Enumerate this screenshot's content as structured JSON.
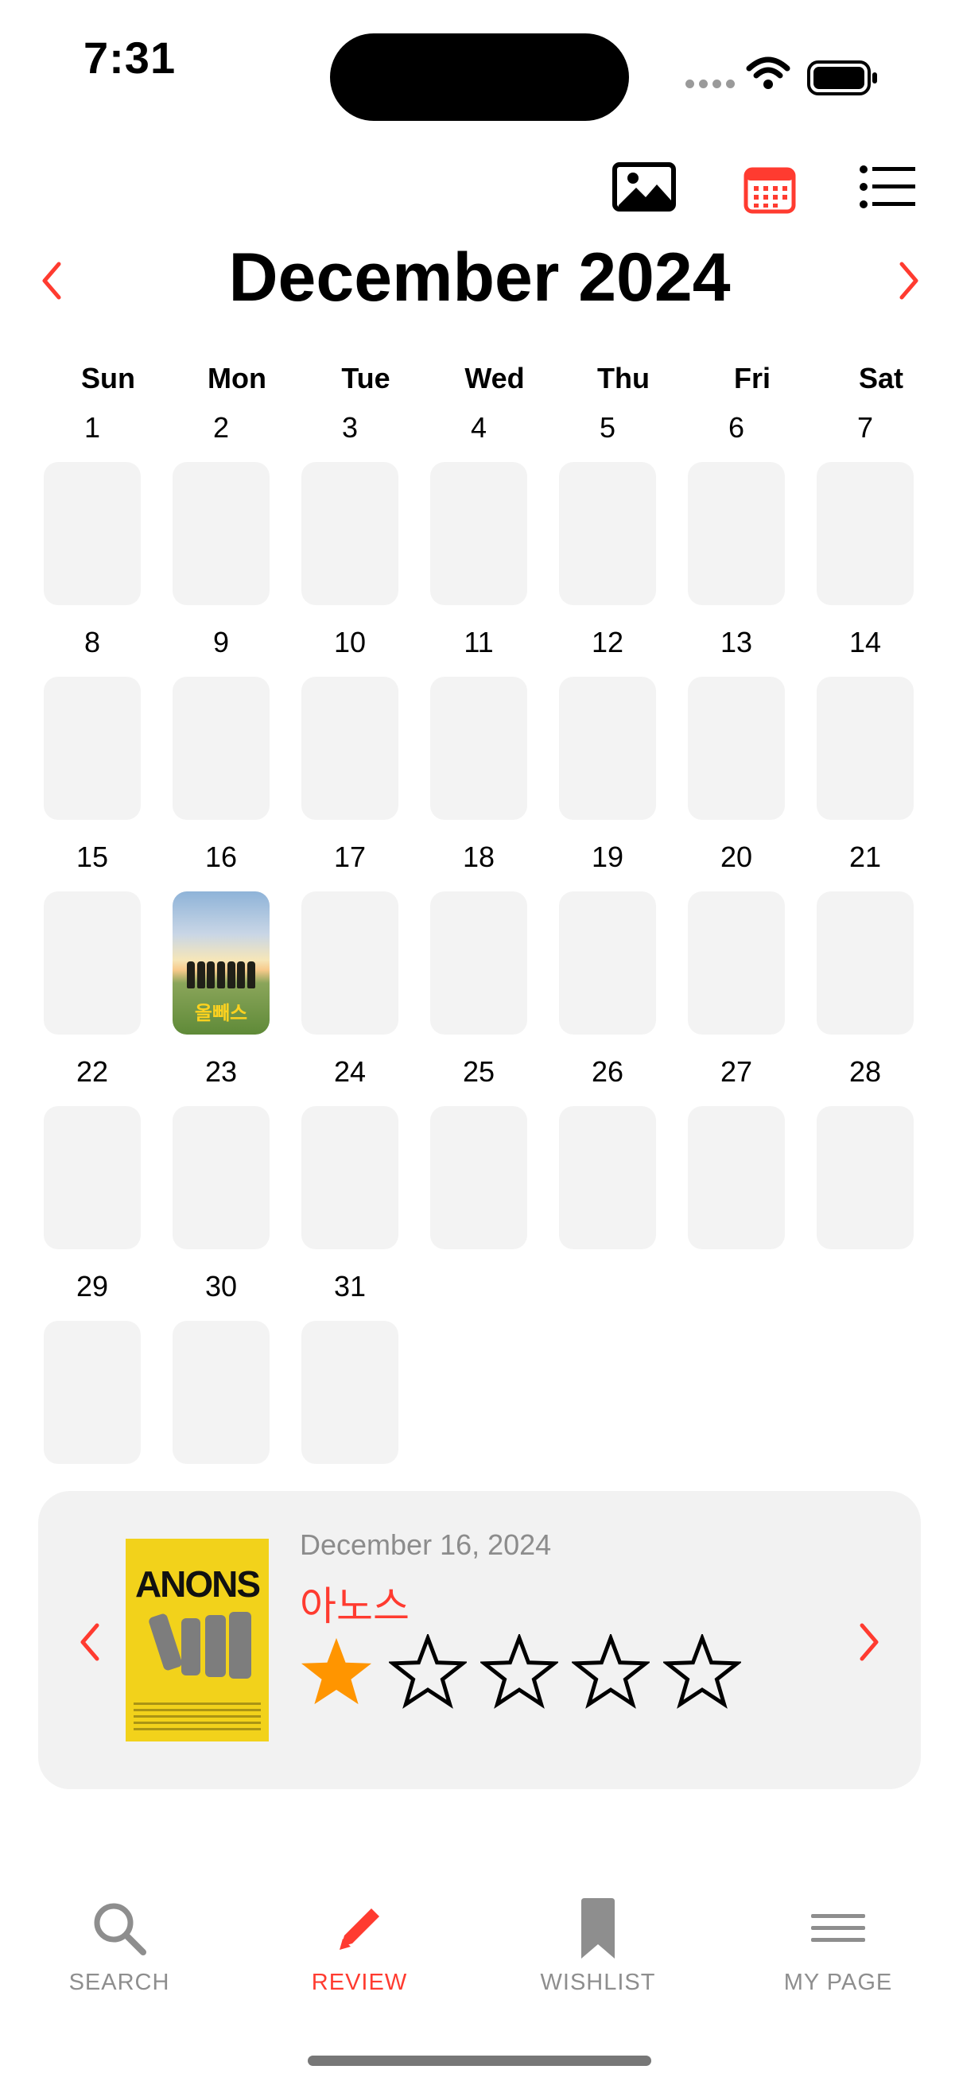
{
  "status": {
    "time": "7:31"
  },
  "toolbar": {
    "icons": [
      "photo-icon",
      "calendar-icon",
      "list-icon"
    ],
    "active_icon": "calendar-icon"
  },
  "calendar": {
    "month_title": "December 2024",
    "weekdays": [
      "Sun",
      "Mon",
      "Tue",
      "Wed",
      "Thu",
      "Fri",
      "Sat"
    ],
    "days": [
      "1",
      "2",
      "3",
      "4",
      "5",
      "6",
      "7",
      "8",
      "9",
      "10",
      "11",
      "12",
      "13",
      "14",
      "15",
      "16",
      "17",
      "18",
      "19",
      "20",
      "21",
      "22",
      "23",
      "24",
      "25",
      "26",
      "27",
      "28",
      "29",
      "30",
      "31"
    ],
    "first_weekday_index": 0,
    "poster_day": "16",
    "poster_day_title": "올빼스"
  },
  "review": {
    "date": "December 16, 2024",
    "title": "아노스",
    "poster_title": "ANONS",
    "rating": 1,
    "max_rating": 5
  },
  "tabs": [
    {
      "label": "SEARCH",
      "icon": "search-icon",
      "active": false
    },
    {
      "label": "REVIEW",
      "icon": "pencil-icon",
      "active": true
    },
    {
      "label": "WISHLIST",
      "icon": "bookmark-icon",
      "active": false
    },
    {
      "label": "MY PAGE",
      "icon": "menu-icon",
      "active": false
    }
  ],
  "colors": {
    "accent": "#ff3b30",
    "star": "#ff9500",
    "cell": "#f3f3f3",
    "card": "#f2f2f2",
    "inactive": "#8e8e8e"
  }
}
